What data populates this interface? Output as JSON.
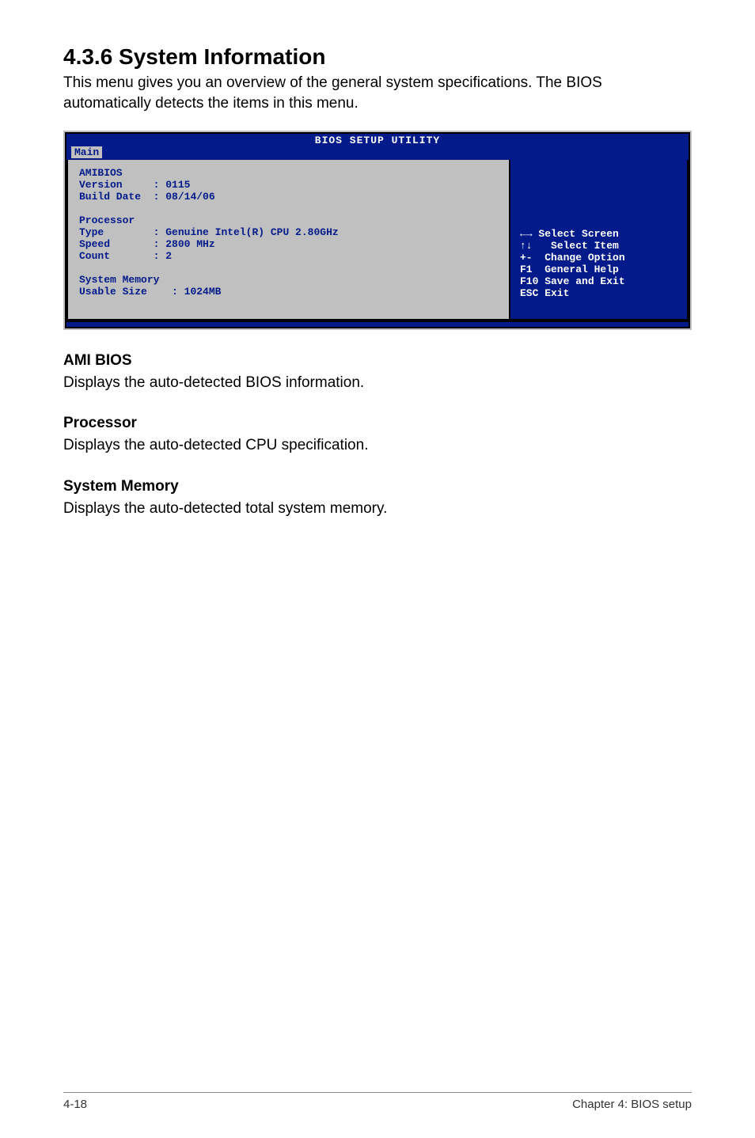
{
  "section_title": "4.3.6 System Information",
  "intro": "This menu gives you an overview of the general system specifications. The BIOS automatically detects the items in this menu.",
  "bios": {
    "title": "BIOS SETUP UTILITY",
    "tab": "Main",
    "left": {
      "amibios_label": "AMIBIOS",
      "version_label": "Version",
      "version_value": "0115",
      "build_date_label": "Build Date",
      "build_date_value": "08/14/06",
      "processor_label": "Processor",
      "type_label": "Type",
      "type_value": "Genuine Intel(R) CPU 2.80GHz",
      "speed_label": "Speed",
      "speed_value": "2800 MHz",
      "count_label": "Count",
      "count_value": "2",
      "sysmem_label": "System Memory",
      "usable_label": "Usable Size",
      "usable_value": "1024MB"
    },
    "right": {
      "select_screen": " Select Screen",
      "select_item": "   Select Item",
      "change_option": "+-  Change Option",
      "general_help": "F1  General Help",
      "save_exit": "F10 Save and Exit",
      "esc_exit": "ESC Exit"
    }
  },
  "sub1_head": "AMI BIOS",
  "sub1_body": "Displays the auto-detected BIOS information.",
  "sub2_head": "Processor",
  "sub2_body": "Displays the auto-detected CPU specification.",
  "sub3_head": "System Memory",
  "sub3_body": "Displays the auto-detected total system memory.",
  "footer_left": "4-18",
  "footer_right": "Chapter 4: BIOS setup",
  "chart_data": {
    "type": "table",
    "title": "BIOS SETUP UTILITY — Main",
    "rows": [
      {
        "group": "AMIBIOS",
        "field": "Version",
        "value": "0115"
      },
      {
        "group": "AMIBIOS",
        "field": "Build Date",
        "value": "08/14/06"
      },
      {
        "group": "Processor",
        "field": "Type",
        "value": "Genuine Intel(R) CPU 2.80GHz"
      },
      {
        "group": "Processor",
        "field": "Speed",
        "value": "2800 MHz"
      },
      {
        "group": "Processor",
        "field": "Count",
        "value": "2"
      },
      {
        "group": "System Memory",
        "field": "Usable Size",
        "value": "1024MB"
      }
    ],
    "help_keys": [
      {
        "key": "←→",
        "action": "Select Screen"
      },
      {
        "key": "↑↓",
        "action": "Select Item"
      },
      {
        "key": "+-",
        "action": "Change Option"
      },
      {
        "key": "F1",
        "action": "General Help"
      },
      {
        "key": "F10",
        "action": "Save and Exit"
      },
      {
        "key": "ESC",
        "action": "Exit"
      }
    ]
  }
}
